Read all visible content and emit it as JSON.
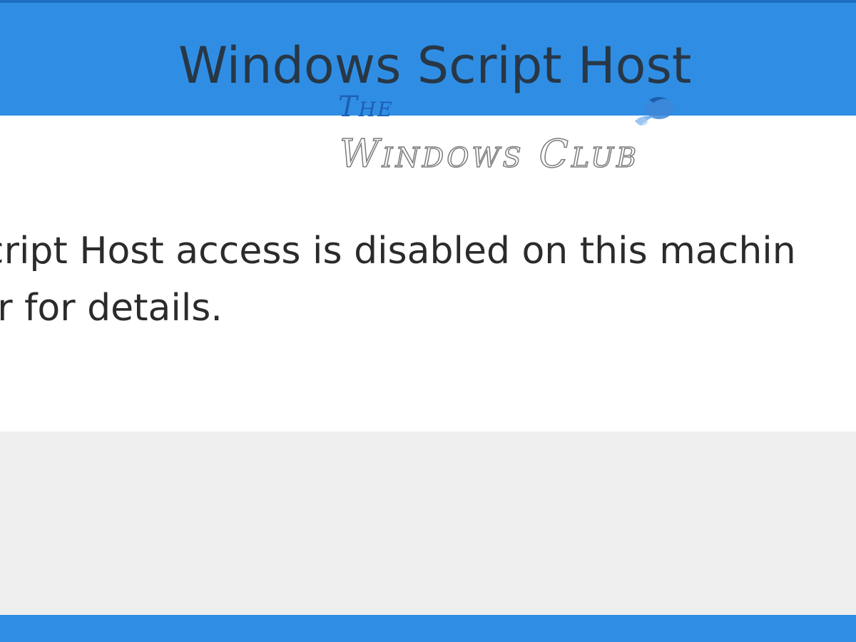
{
  "window": {
    "title": "Windows Script Host",
    "accent_color": "#2f8ee4",
    "footer_color": "#efefef"
  },
  "message": {
    "line1": "Script Host access is disabled on this machin",
    "line2": "tor for details."
  },
  "watermark": {
    "line1": "The",
    "line2": "Windows Club",
    "logo_icon": "windows-club-logo-icon"
  }
}
